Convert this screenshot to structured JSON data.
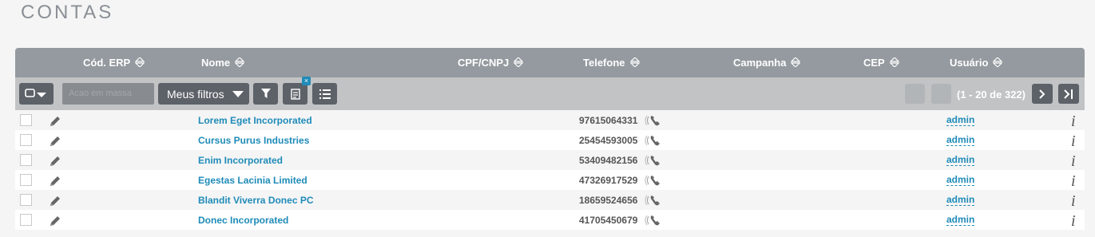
{
  "page": {
    "title": "CONTAS"
  },
  "columns": {
    "cod_erp": "Cód. ERP",
    "nome": "Nome",
    "cpf_cnpj": "CPF/CNPJ",
    "telefone": "Telefone",
    "campanha": "Campanha",
    "cep": "CEP",
    "usuario": "Usuário"
  },
  "toolbar": {
    "search_placeholder": "Acao em massa",
    "filters_label": "Meus filtros",
    "filter_badge": "×",
    "pagination": "(1 - 20 de 322)"
  },
  "rows": [
    {
      "name": "Lorem Eget Incorporated",
      "phone": "97615064331",
      "user": "admin",
      "info": "i"
    },
    {
      "name": "Cursus Purus Industries",
      "phone": "25454593005",
      "user": "admin",
      "info": "i"
    },
    {
      "name": "Enim Incorporated",
      "phone": "53409482156",
      "user": "admin",
      "info": "i"
    },
    {
      "name": "Egestas Lacinia Limited",
      "phone": "47326917529",
      "user": "admin",
      "info": "i"
    },
    {
      "name": "Blandit Viverra Donec PC",
      "phone": "18659524656",
      "user": "admin",
      "info": "i"
    },
    {
      "name": "Donec Incorporated",
      "phone": "41705450679",
      "user": "admin",
      "info": "i"
    }
  ],
  "colors": {
    "link": "#1f8bb8",
    "header": "#949a9f",
    "toolbar": "#c1c3c5",
    "button": "#5d6168"
  }
}
